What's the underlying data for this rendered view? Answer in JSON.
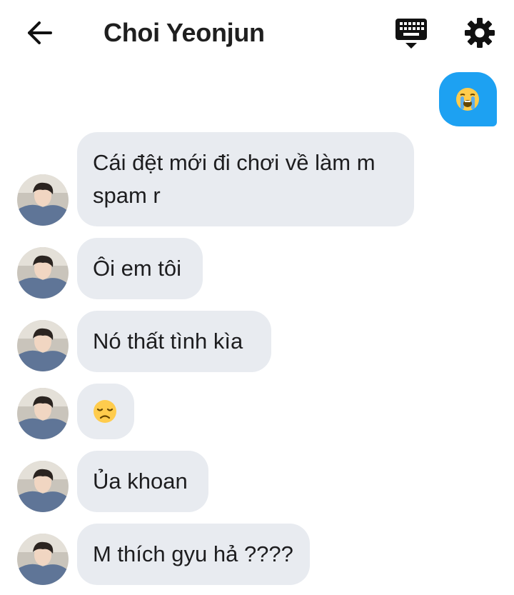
{
  "header": {
    "title": "Choi Yeonjun",
    "back_icon": "arrow-left-icon",
    "keyboard_icon": "keyboard-icon",
    "settings_icon": "gear-icon"
  },
  "colors": {
    "sent_bubble": "#1da1f2",
    "received_bubble": "#e8ebf0",
    "text": "#1d1d1f"
  },
  "messages": [
    {
      "direction": "sent",
      "type": "emoji",
      "emoji": "loudly-crying-face"
    },
    {
      "direction": "received",
      "type": "text",
      "text": "Cái đệt mới đi chơi về làm m\nspam r"
    },
    {
      "direction": "received",
      "type": "text",
      "text": "Ôi em tôi"
    },
    {
      "direction": "received",
      "type": "text",
      "text": "Nó thất tình kìa"
    },
    {
      "direction": "received",
      "type": "emoji",
      "emoji": "disappointed-face"
    },
    {
      "direction": "received",
      "type": "text",
      "text": "Ủa khoan"
    },
    {
      "direction": "received",
      "type": "text",
      "text": "M thích gyu hả ????"
    }
  ]
}
